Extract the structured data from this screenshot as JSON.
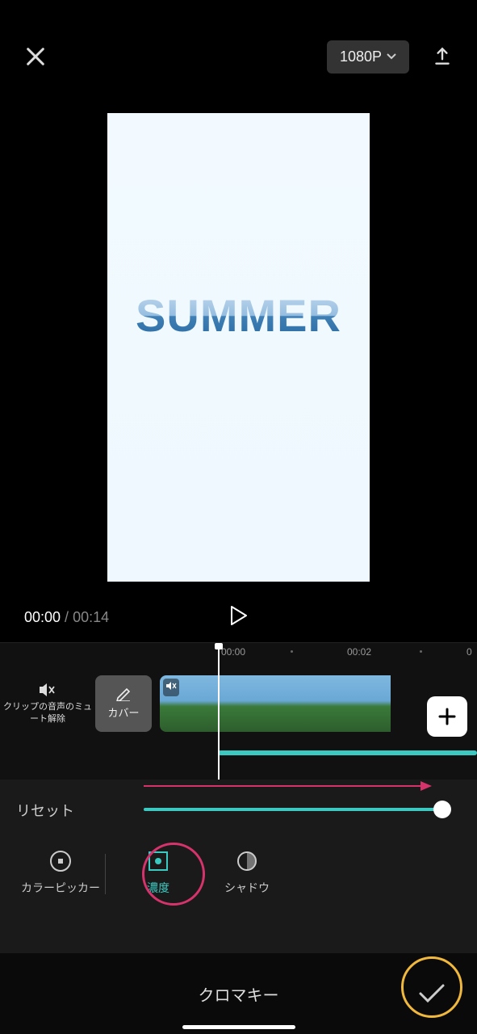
{
  "header": {
    "resolution": "1080P"
  },
  "preview": {
    "text": "SUMMER"
  },
  "playback": {
    "current": "00:00",
    "total": "00:14"
  },
  "timeline": {
    "ticks": [
      "00:00",
      "00:02"
    ],
    "tick_partial": "0",
    "mute_label": "クリップの音声のミュート解除",
    "cover_label": "カバー"
  },
  "controls": {
    "reset_label": "リセット",
    "options": {
      "color_picker": "カラーピッカー",
      "intensity": "濃度",
      "shadow": "シャドウ"
    }
  },
  "bottom": {
    "title": "クロマキー"
  }
}
